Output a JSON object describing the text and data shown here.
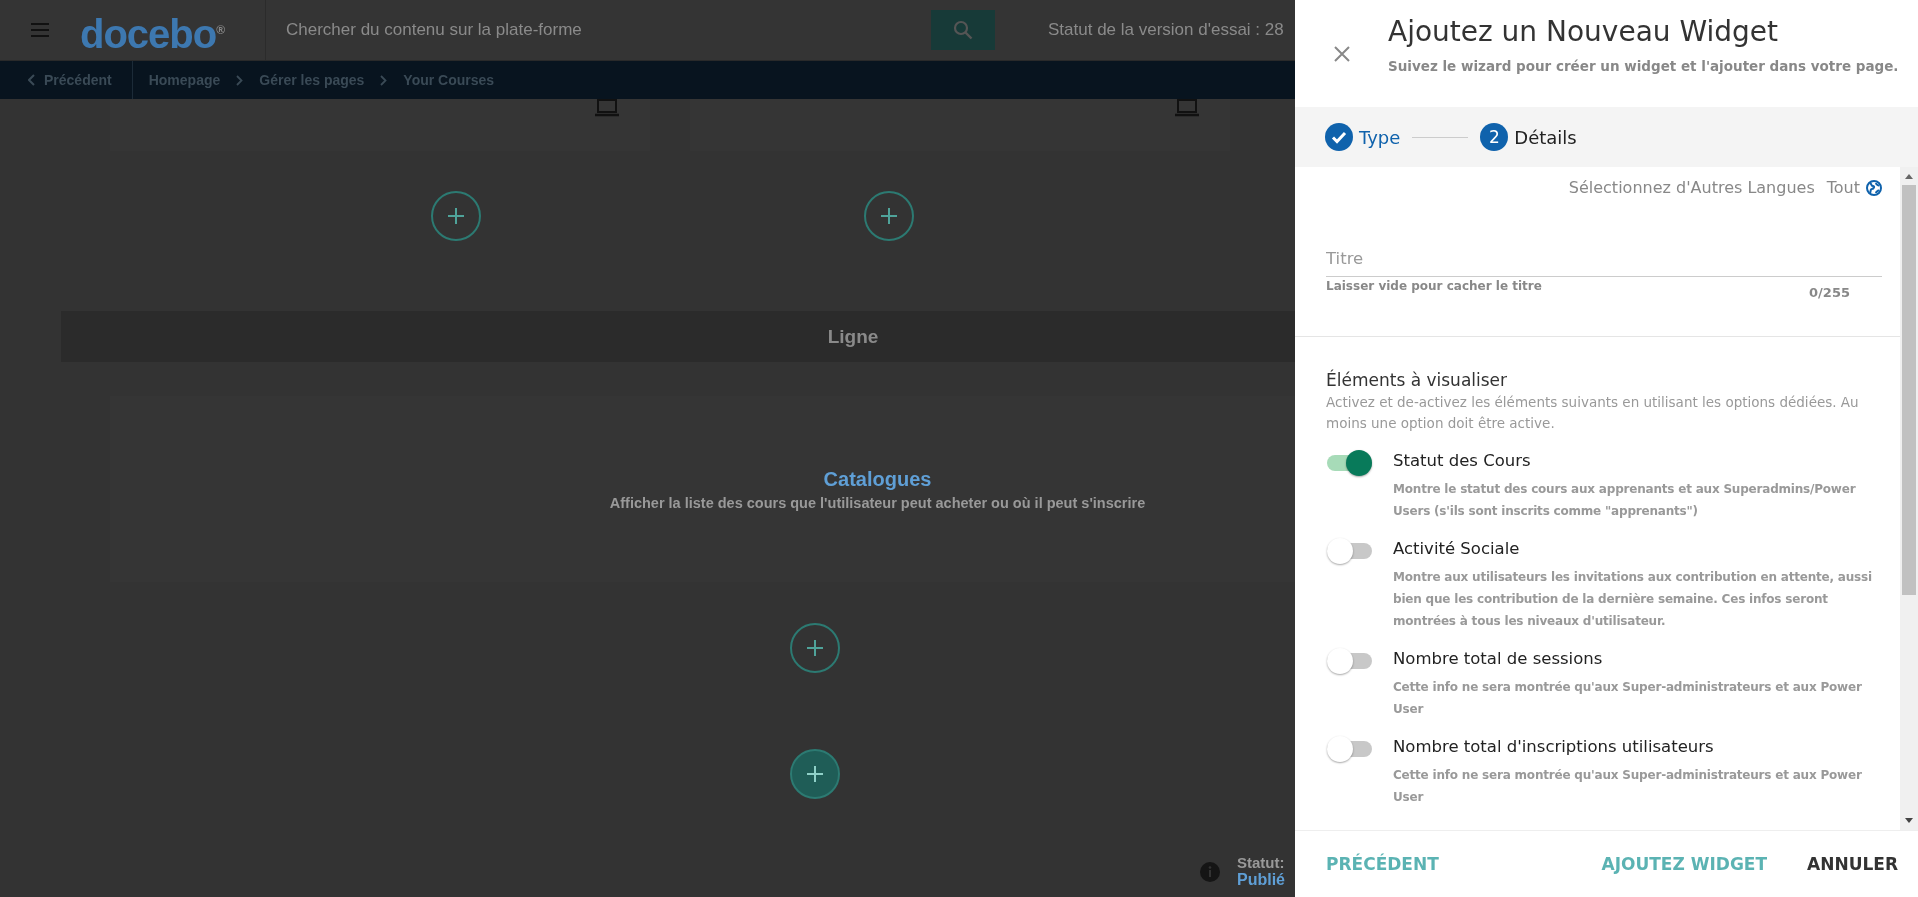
{
  "header": {
    "logo": "docebo",
    "logo_mark": "®",
    "search": {
      "placeholder": "Chercher du contenu sur la plate-forme"
    },
    "trial_status": "Statut de la version d'essai : 28"
  },
  "breadcrumb": {
    "back": "Précédent",
    "items": [
      "Homepage",
      "Gérer les pages",
      "Your Courses"
    ]
  },
  "page": {
    "row_label": "Ligne",
    "widget": {
      "title": "Catalogues",
      "description": "Afficher la liste des cours que l'utilisateur peut acheter ou où il peut s'inscrire"
    },
    "status": {
      "label": "Statut:",
      "value": "Publié"
    }
  },
  "panel": {
    "title": "Ajoutez un Nouveau Widget",
    "subtitle": "Suivez le wizard pour créer un widget et l'ajouter dans votre page.",
    "steps": [
      {
        "kind": "done",
        "label": "Type",
        "selected": false
      },
      {
        "kind": "number",
        "number": "2",
        "label": "Détails",
        "selected": true
      }
    ],
    "languages": {
      "label": "Sélectionnez d'Autres Langues",
      "value": "Tout"
    },
    "title_field": {
      "placeholder": "Titre",
      "helper": "Laisser vide pour cacher le titre",
      "counter": "0/255"
    },
    "section": {
      "title": "Éléments à visualiser",
      "description": "Activez et de-activez les éléments suivants en utilisant les options dédiées. Au moins une option doit être active."
    },
    "toggles": [
      {
        "label": "Statut des Cours",
        "description": "Montre le statut des cours aux apprenants et aux Superadmins/Power Users (s'ils sont inscrits comme \"apprenants\")",
        "on": true
      },
      {
        "label": "Activité Sociale",
        "description": "Montre aux utilisateurs les invitations aux contribution en attente, aussi bien que les contribution de la dernière semaine. Ces infos seront montrées à tous les niveaux d'utilisateur.",
        "on": false
      },
      {
        "label": "Nombre total de sessions",
        "description": "Cette info ne sera montrée qu'aux Super-administrateurs et aux Power User",
        "on": false
      },
      {
        "label": "Nombre total d'inscriptions utilisateurs",
        "description": "Cette info ne sera montrée qu'aux Super-administrateurs et aux Power User",
        "on": false
      }
    ],
    "buttons": {
      "back": "PRÉCÉDENT",
      "add": "AJOUTEZ WIDGET",
      "cancel": "ANNULER"
    }
  }
}
